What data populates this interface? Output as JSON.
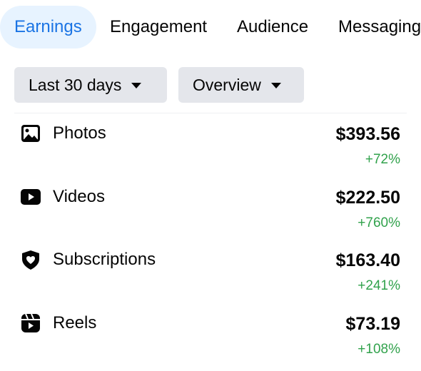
{
  "tabs": [
    {
      "label": "Earnings",
      "active": true
    },
    {
      "label": "Engagement",
      "active": false
    },
    {
      "label": "Audience",
      "active": false
    },
    {
      "label": "Messaging",
      "active": false
    }
  ],
  "filters": {
    "date_range": "Last 30 days",
    "view": "Overview"
  },
  "earnings": [
    {
      "icon": "photo-icon",
      "label": "Photos",
      "amount": "$393.56",
      "change": "+72%"
    },
    {
      "icon": "video-play-icon",
      "label": "Videos",
      "amount": "$222.50",
      "change": "+760%"
    },
    {
      "icon": "heart-shield-icon",
      "label": "Subscriptions",
      "amount": "$163.40",
      "change": "+241%"
    },
    {
      "icon": "reels-icon",
      "label": "Reels",
      "amount": "$73.19",
      "change": "+108%"
    }
  ],
  "colors": {
    "accent": "#1b74e4",
    "active_tab_bg": "#e7f3ff",
    "filter_bg": "#e4e6eb",
    "positive": "#31a24c",
    "text": "#050505"
  }
}
